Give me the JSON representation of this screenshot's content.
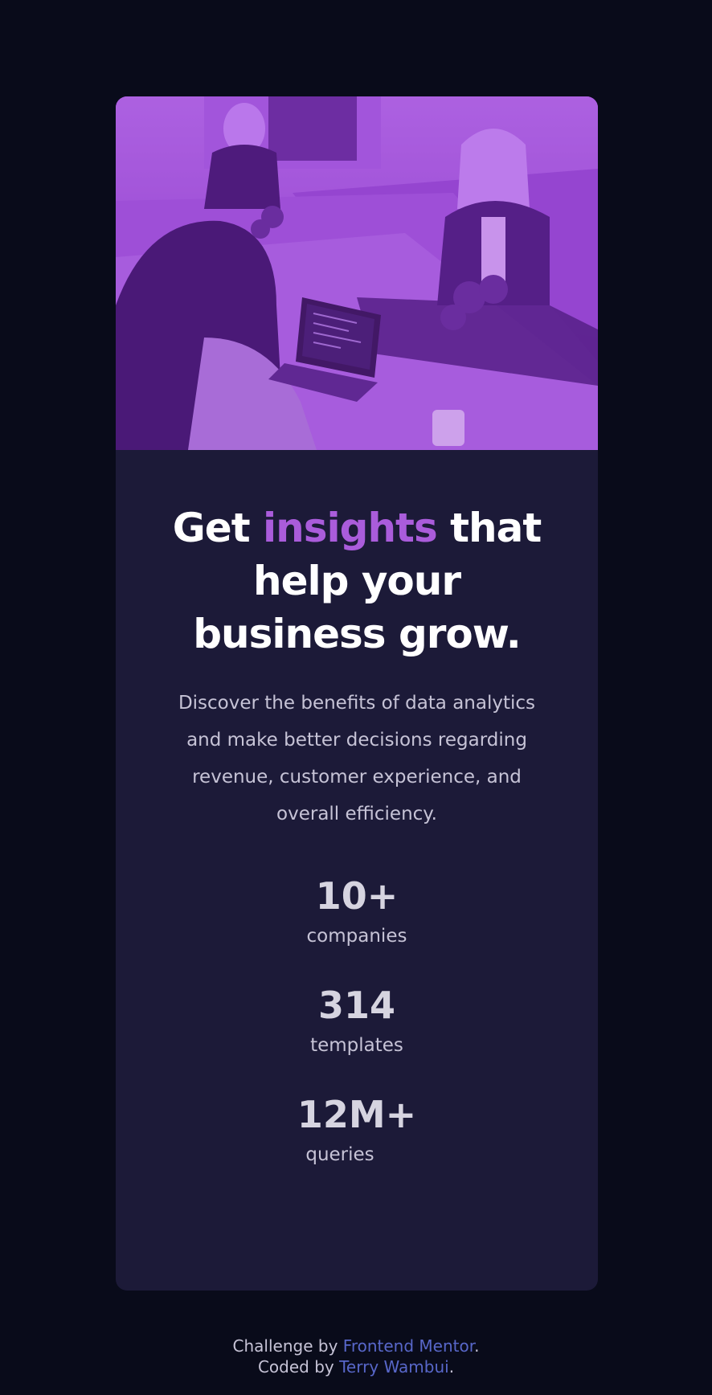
{
  "hero": {
    "image_label": "Team working at tables with laptops"
  },
  "headline": {
    "part1": "Get ",
    "accent": "insights",
    "part2": " that help your business grow."
  },
  "description": "Discover the benefits of data analytics and make better decisions regarding revenue, customer experience, and overall efficiency.",
  "stats": [
    {
      "value": "10+",
      "label": "companies"
    },
    {
      "value": "314",
      "label": "templates"
    },
    {
      "value": "12M+",
      "label": "queries"
    }
  ],
  "footer": {
    "line1_prefix": "Challenge by ",
    "line1_link": "Frontend Mentor",
    "line1_suffix": ".",
    "line2_prefix": "Coded by ",
    "line2_link": "Terry Wambui",
    "line2_suffix": "."
  },
  "colors": {
    "background": "#090b1a",
    "card": "#1c1a38",
    "accent": "#aa5cdb",
    "link": "#5867c9",
    "text_muted": "#c6c3d6"
  }
}
